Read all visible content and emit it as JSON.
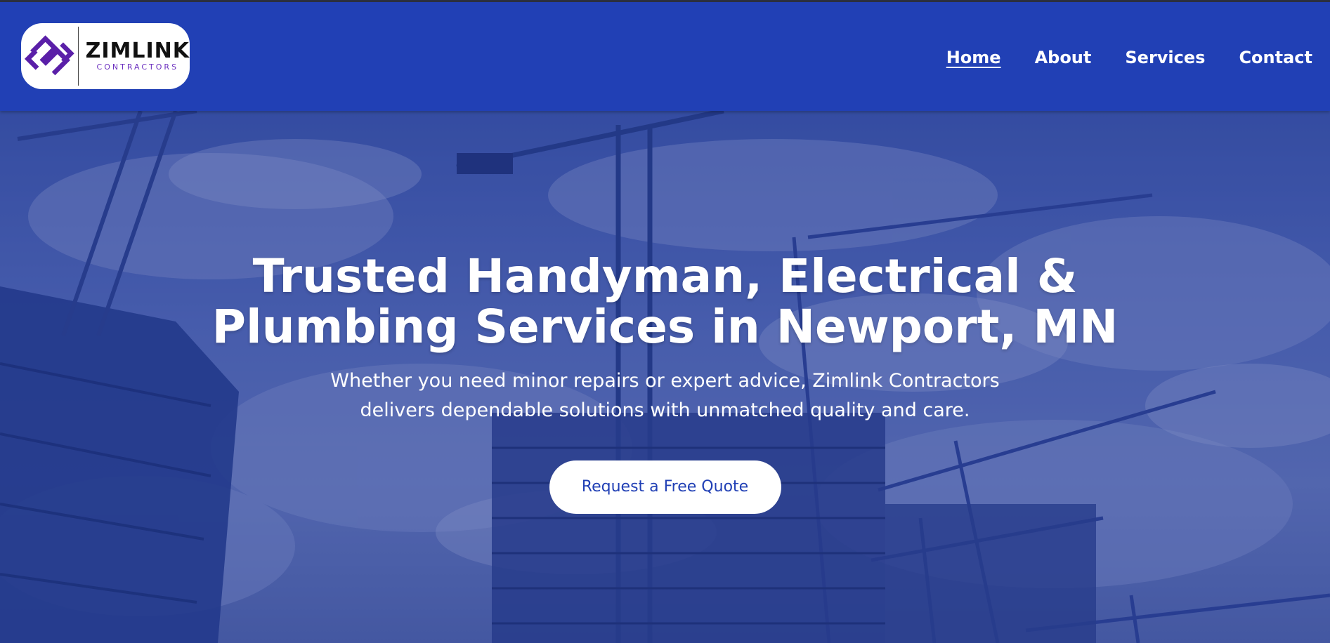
{
  "brand": {
    "name": "ZIMLINK",
    "tagline": "CONTRACTORS",
    "accent": "#6b2fbf"
  },
  "header": {
    "background": "#2140b5",
    "nav": [
      {
        "label": "Home",
        "active": true
      },
      {
        "label": "About",
        "active": false
      },
      {
        "label": "Services",
        "active": false
      },
      {
        "label": "Contact",
        "active": false
      }
    ]
  },
  "hero": {
    "title": "Trusted Handyman, Electrical & Plumbing Services in Newport, MN",
    "subtitle": "Whether you need minor repairs or expert advice, Zimlink Contractors delivers dependable solutions with unmatched quality and care.",
    "cta_label": "Request a Free Quote",
    "background_icon": "construction-cranes-image"
  }
}
